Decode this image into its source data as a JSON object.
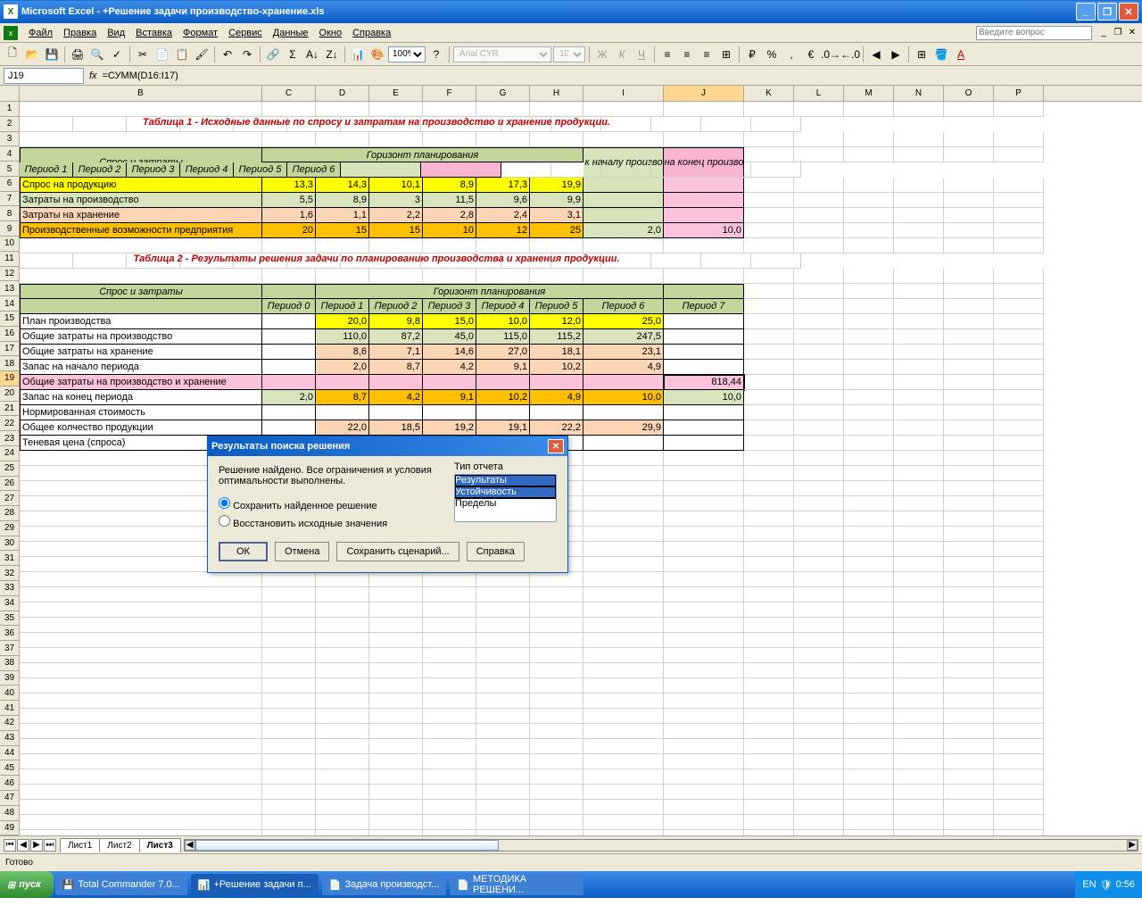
{
  "app": {
    "title": "Microsoft Excel - +Решение задачи производство-хранение.xls"
  },
  "menu": [
    "Файл",
    "Правка",
    "Вид",
    "Вставка",
    "Формат",
    "Сервис",
    "Данные",
    "Окно",
    "Справка"
  ],
  "ask_placeholder": "Введите вопрос",
  "toolbar": {
    "font": "Arial CYR",
    "size": "10",
    "zoom": "100%"
  },
  "formula": {
    "cell": "J19",
    "fx": "fx",
    "value": "=СУММ(D16:I17)"
  },
  "cols": [
    "B",
    "C",
    "D",
    "E",
    "F",
    "G",
    "H",
    "I",
    "J",
    "K",
    "L",
    "M",
    "N",
    "O",
    "P"
  ],
  "rows_count": 49,
  "t1": {
    "title": "Таблица 1 - Исходные данные по спросу и затратам на производство и хранение продукции.",
    "h_spros": "Спрос и затраты",
    "h_gor": "Горизонт планирования",
    "h_zn": "Запас к началу производства",
    "h_zk": "Запас на конец производства",
    "periods": [
      "Период 1",
      "Период 2",
      "Период 3",
      "Период 4",
      "Период 5",
      "Период 6"
    ],
    "rows": [
      {
        "label": "Спрос на продукцию",
        "v": [
          "13,3",
          "14,3",
          "10,1",
          "8,9",
          "17,3",
          "19,9"
        ],
        "cls": "bg-yellow"
      },
      {
        "label": "Затраты на производство",
        "v": [
          "5,5",
          "8,9",
          "3",
          "11,5",
          "9,6",
          "9,9"
        ],
        "cls": "bg-lgreen"
      },
      {
        "label": "Затраты на хранение",
        "v": [
          "1,6",
          "1,1",
          "2,2",
          "2,8",
          "2,4",
          "3,1"
        ],
        "cls": "bg-peach"
      },
      {
        "label": "Производственные возможности предприятия",
        "v": [
          "20",
          "15",
          "15",
          "10",
          "12",
          "25"
        ],
        "cls": "bg-orange"
      }
    ],
    "zn": "2,0",
    "zk": "10,0"
  },
  "t2": {
    "title": "Таблица 2 - Результаты решения задачи по планированию производства и хранения продукции.",
    "h_spros": "Спрос и затраты",
    "h_gor": "Горизонт планирования",
    "p0": "Период 0",
    "periods": [
      "Период 1",
      "Период 2",
      "Период 3",
      "Период 4",
      "Период 5",
      "Период 6"
    ],
    "p7": "Период 7",
    "rows": [
      {
        "label": "План производства",
        "p0": "",
        "v": [
          "20,0",
          "9,8",
          "15,0",
          "10,0",
          "12,0",
          "25,0"
        ],
        "p7": "",
        "cls": "bg-yellow"
      },
      {
        "label": "Общие  затраты на производство",
        "p0": "",
        "v": [
          "110,0",
          "87,2",
          "45,0",
          "115,0",
          "115,2",
          "247,5"
        ],
        "p7": "",
        "cls": "bg-lgreen"
      },
      {
        "label": "Общие  затраты на хранение",
        "p0": "",
        "v": [
          "8,6",
          "7,1",
          "14,6",
          "27,0",
          "18,1",
          "23,1"
        ],
        "p7": "",
        "cls": "bg-peach"
      },
      {
        "label": "Запас на начало периода",
        "p0": "",
        "v": [
          "2,0",
          "8,7",
          "4,2",
          "9,1",
          "10,2",
          "4,9"
        ],
        "p7": "",
        "cls": "bg-peach"
      },
      {
        "label": "Общие затраты на производство и хранение",
        "p0": "",
        "v": [
          "",
          "",
          "",
          "",
          "",
          ""
        ],
        "p7": "818,44",
        "cls": "bg-pink"
      },
      {
        "label": "Запас на конец периода",
        "p0": "2,0",
        "v": [
          "8,7",
          "4,2",
          "9,1",
          "10,2",
          "4,9",
          "10,0"
        ],
        "p7": "10,0",
        "cls": "bg-orange",
        "p0cls": "bg-lgreen",
        "p7cls": "bg-lgreen"
      },
      {
        "label": "Нормированная стоимость",
        "p0": "",
        "v": [
          "",
          "",
          "",
          "",
          "",
          ""
        ],
        "p7": "",
        "cls": ""
      },
      {
        "label": "Общее колчество продукции",
        "p0": "",
        "v": [
          "22,0",
          "18,5",
          "19,2",
          "19,1",
          "22,2",
          "29,9"
        ],
        "p7": "",
        "cls": "bg-peach"
      },
      {
        "label": "Теневая цена (спроса)",
        "p0": "",
        "v": [
          "",
          "",
          "",
          "",
          "",
          ""
        ],
        "p7": "",
        "cls": ""
      }
    ]
  },
  "dialog": {
    "title": "Результаты поиска решения",
    "msg": "Решение найдено. Все ограничения и условия оптимальности выполнены.",
    "r1": "Сохранить найденное решение",
    "r2": "Восстановить исходные значения",
    "report_lbl": "Тип отчета",
    "reports": [
      "Результаты",
      "Устойчивость",
      "Пределы"
    ],
    "ok": "ОК",
    "cancel": "Отмена",
    "save": "Сохранить сценарий...",
    "help": "Справка"
  },
  "tabs": [
    "Лист1",
    "Лист2",
    "Лист3"
  ],
  "status": "Готово",
  "taskbar": {
    "start": "пуск",
    "items": [
      "Total Commander 7.0...",
      "+Решение задачи п...",
      "Задача производст...",
      "МЕТОДИКА РЕШЕНИ..."
    ],
    "lang": "EN",
    "time": "0:56"
  }
}
